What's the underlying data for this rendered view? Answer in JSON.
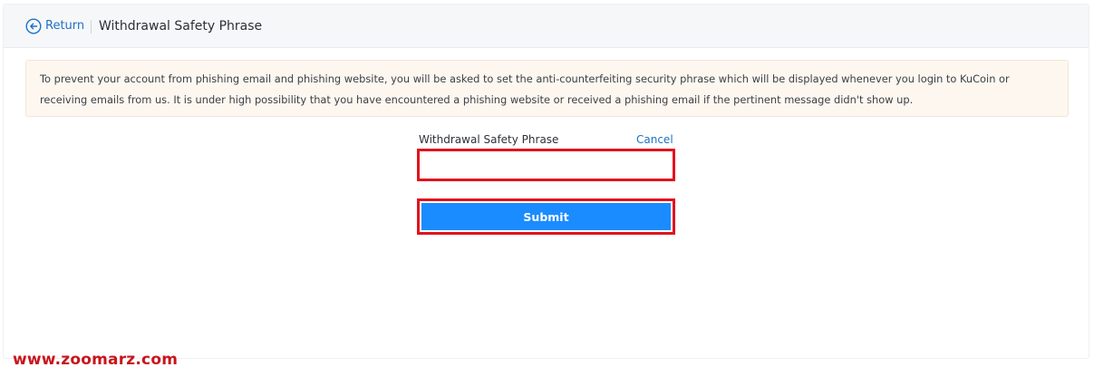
{
  "header": {
    "return_label": "Return",
    "title": "Withdrawal Safety Phrase",
    "return_icon": "arrow-left-circle-icon"
  },
  "notice": {
    "text": "To prevent your account from phishing email and phishing website, you will be asked to set the anti-counterfeiting security phrase which will be displayed whenever you login to KuCoin or receiving emails from us. It is under high possibility that you have encountered a phishing website or received a phishing email if the pertinent message didn't show up."
  },
  "form": {
    "field_label": "Withdrawal Safety Phrase",
    "cancel_label": "Cancel",
    "input_value": "",
    "submit_label": "Submit"
  },
  "watermark": {
    "text": "www.zoomarz.com"
  },
  "colors": {
    "accent": "#1d71c6",
    "submit_bg": "#1a8cff",
    "highlight_border": "#e0141e",
    "notice_bg": "#fdf7f0",
    "watermark": "#c8151c"
  }
}
